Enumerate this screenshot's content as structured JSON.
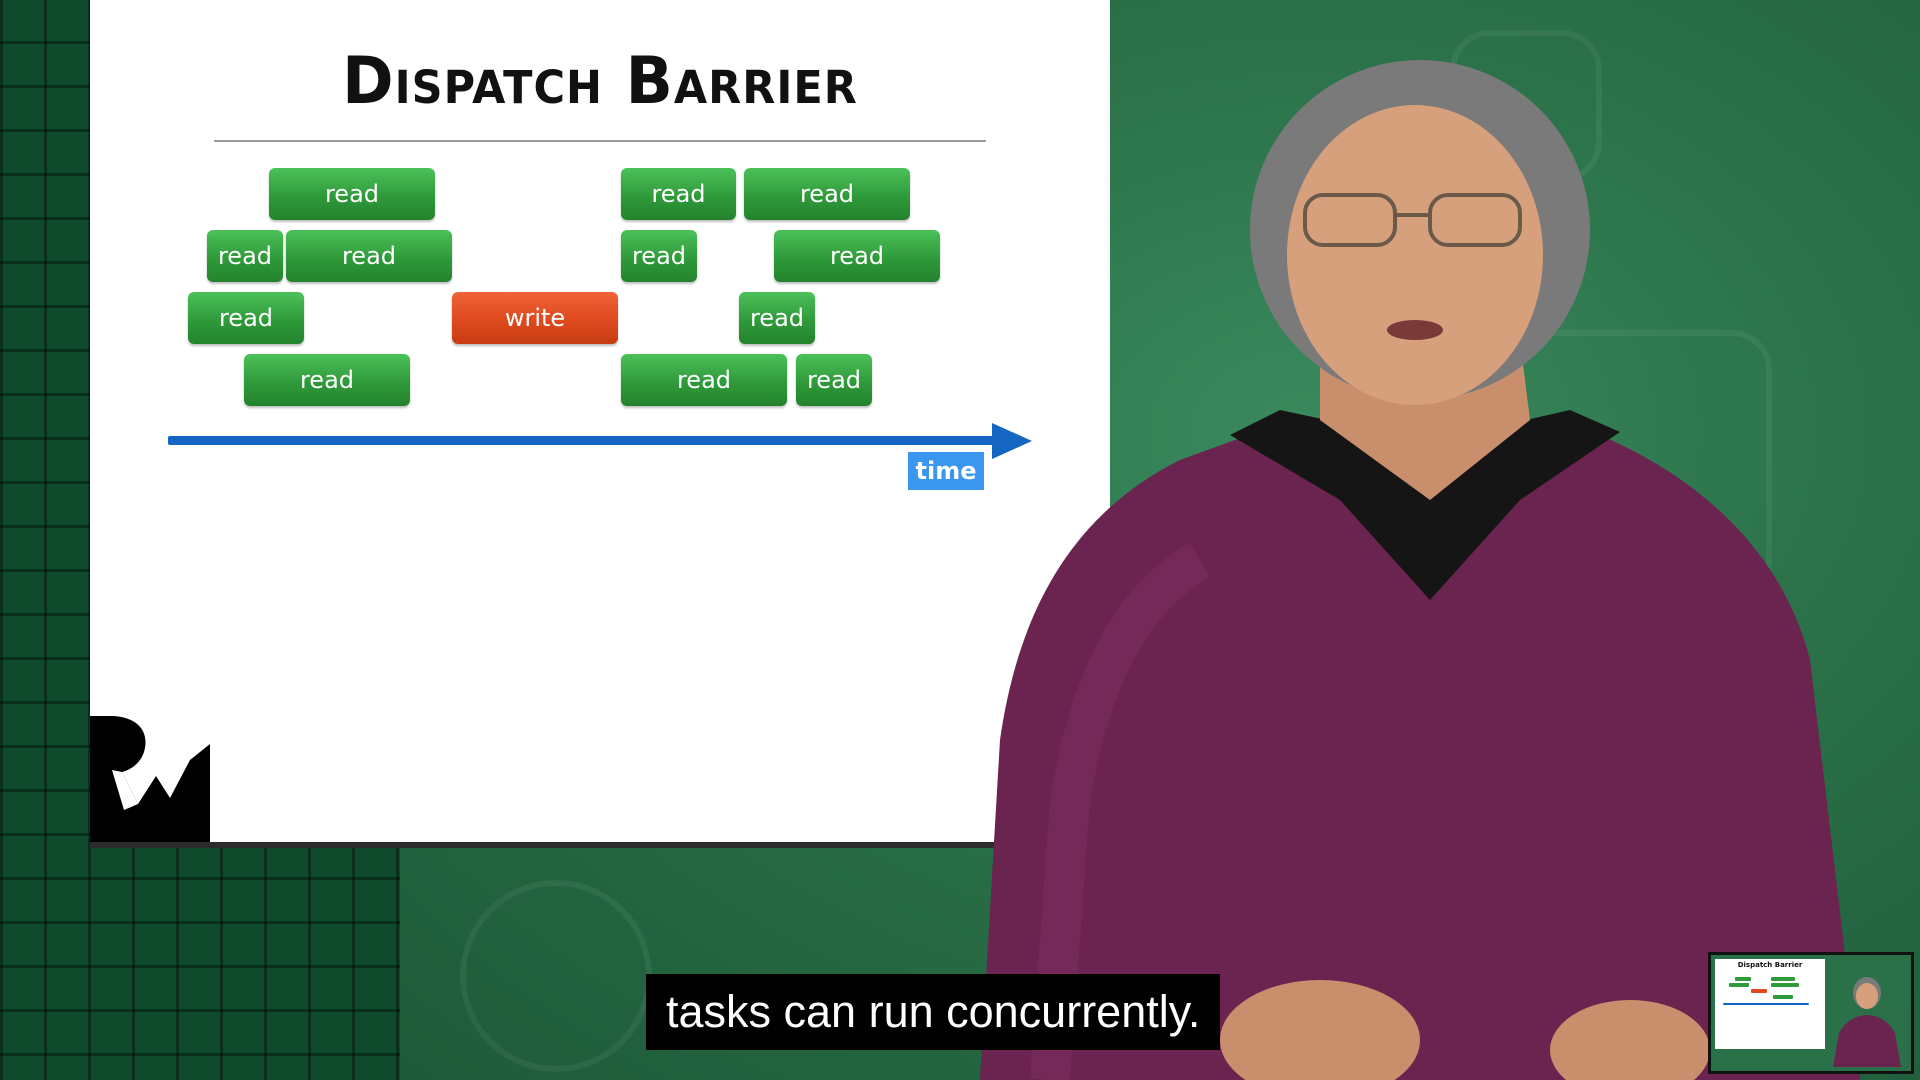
{
  "slide": {
    "title": "Dispatch Barrier",
    "time_label": "time",
    "tasks": [
      {
        "kind": "read",
        "label": "read"
      },
      {
        "kind": "read",
        "label": "read"
      },
      {
        "kind": "read",
        "label": "read"
      },
      {
        "kind": "read",
        "label": "read"
      },
      {
        "kind": "read",
        "label": "read"
      },
      {
        "kind": "write",
        "label": "write"
      },
      {
        "kind": "read",
        "label": "read"
      },
      {
        "kind": "read",
        "label": "read"
      },
      {
        "kind": "read",
        "label": "read"
      },
      {
        "kind": "read",
        "label": "read"
      },
      {
        "kind": "read",
        "label": "read"
      },
      {
        "kind": "read",
        "label": "read"
      },
      {
        "kind": "read",
        "label": "read"
      }
    ]
  },
  "caption": "tasks can run concurrently.",
  "colors": {
    "read": "#2f9a3a",
    "write": "#de4a1e",
    "timeline": "#1466c2",
    "time_label": "#3a96ee"
  },
  "icons": [
    "rw-logo-icon",
    "presenter-video",
    "pip-thumbnail"
  ]
}
